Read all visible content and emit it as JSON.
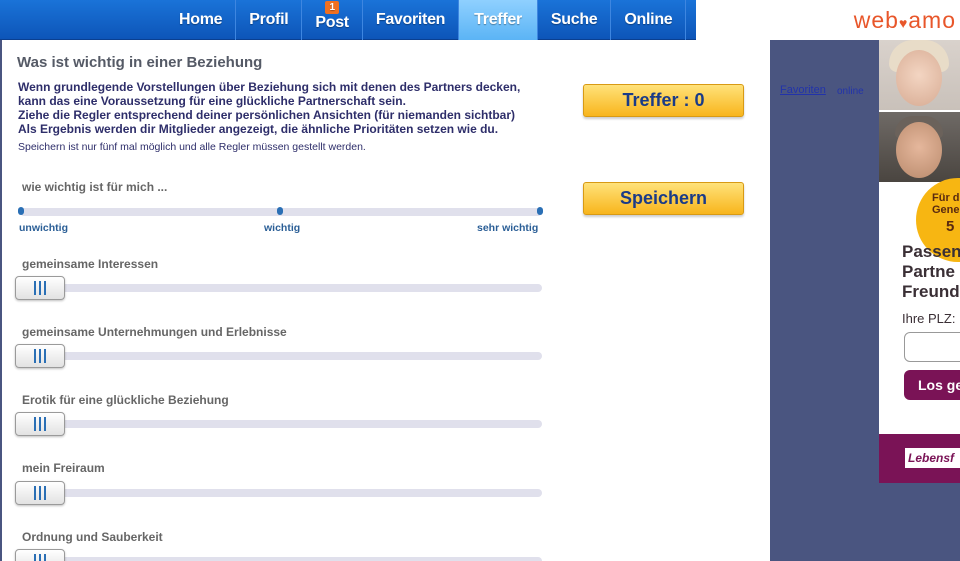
{
  "nav": {
    "items": [
      {
        "label": "Home",
        "active": false
      },
      {
        "label": "Profil",
        "active": false
      },
      {
        "label": "Post",
        "active": false,
        "badge": "1"
      },
      {
        "label": "Favoriten",
        "active": false
      },
      {
        "label": "Treffer",
        "active": true
      },
      {
        "label": "Suche",
        "active": false
      },
      {
        "label": "Online",
        "active": false
      }
    ]
  },
  "logo": {
    "text_left": "web",
    "text_right": "amo"
  },
  "main": {
    "title": "Was ist wichtig in einer Beziehung",
    "intro_lines": [
      "Wenn grundlegende Vorstellungen über Beziehung sich mit denen des Partners decken,",
      "kann das eine Voraussetzung für eine glückliche Partnerschaft sein.",
      "Ziehe die Regler entsprechend deiner persönlichen Ansichten (für niemanden sichtbar)",
      "Als Ergebnis werden dir Mitglieder angezeigt, die ähnliche Prioritäten setzen wie du."
    ],
    "note": "Speichern ist nur fünf mal möglich und alle Regler müssen gestellt werden.",
    "hits_button": "Treffer :  0",
    "save_button": "Speichern",
    "scale": {
      "label": "wie wichtig ist für mich ...",
      "low": "unwichtig",
      "mid": "wichtig",
      "high": "sehr wichtig"
    },
    "sliders": [
      {
        "label": "gemeinsame Interessen",
        "value": 0
      },
      {
        "label": "gemeinsame Unternehmungen und Erlebnisse",
        "value": 0
      },
      {
        "label": "Erotik für eine glückliche Beziehung",
        "value": 0
      },
      {
        "label": "mein Freiraum",
        "value": 0
      },
      {
        "label": "Ordnung und Sauberkeit",
        "value": 0
      }
    ]
  },
  "side": {
    "favorites_link": "Favoriten",
    "online_label": "online"
  },
  "ad": {
    "badge_line1": "Für d",
    "badge_line2": "Gener",
    "badge_number": "5",
    "headline_lines": [
      "Passen",
      "Partne",
      "Freund"
    ],
    "plz_label": "Ihre PLZ:",
    "button": "Los ge",
    "footer_tag": "Lebensf"
  },
  "colors": {
    "nav_bg": "#0d55b8",
    "nav_active": "#5bb4f5",
    "button_gold": "#f8b51c",
    "button_text": "#1a3b88",
    "ad_accent": "#7a1356",
    "page_bg": "#4a5580"
  }
}
